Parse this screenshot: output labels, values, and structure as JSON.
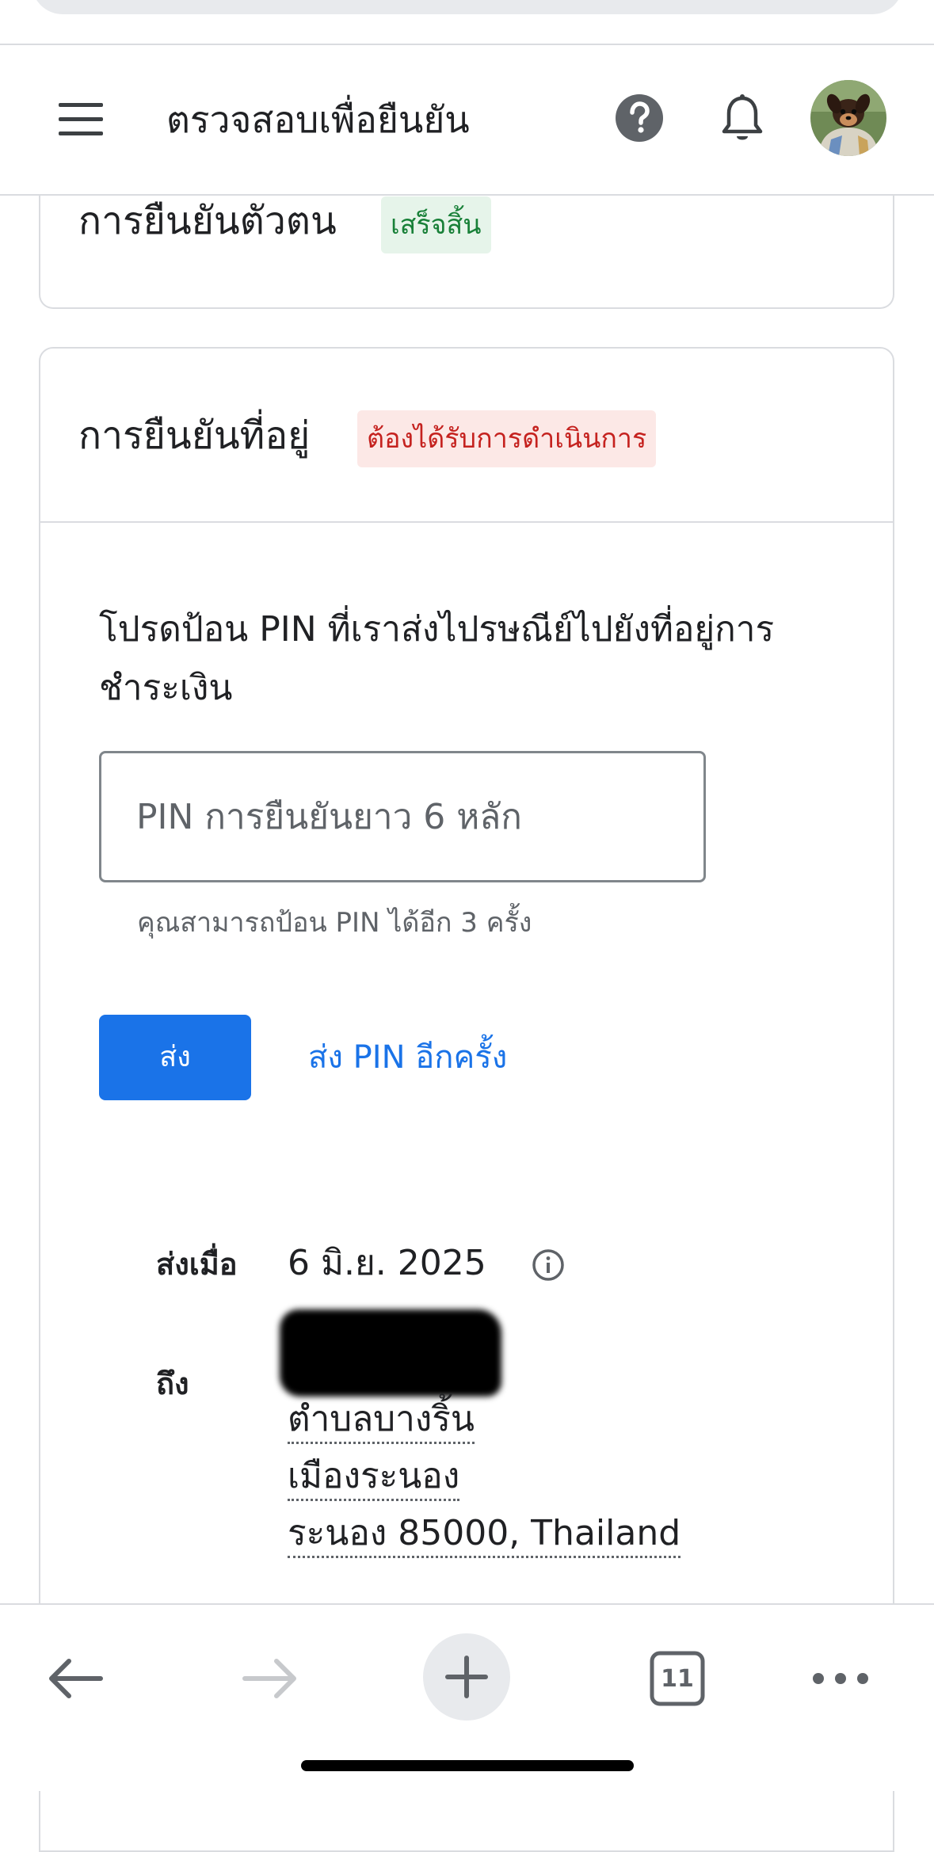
{
  "header": {
    "title": "ตรวจสอบเพื่อยืนยัน",
    "menu_icon": "menu-icon",
    "help_icon": "help-icon",
    "notifications_icon": "bell-icon",
    "avatar": "account-avatar"
  },
  "identity_card": {
    "title": "การยืนยันตัวตน",
    "status": "เสร็จสิ้น"
  },
  "address_card": {
    "title": "การยืนยันที่อยู่",
    "status": "ต้องได้รับการดำเนินการ",
    "instruction": "โปรดป้อน PIN ที่เราส่งไปรษณีย์ไปยังที่อยู่การชำระเงิน",
    "pin_input": {
      "placeholder": "PIN การยืนยันยาว 6 หลัก",
      "value": ""
    },
    "helper_text": "คุณสามารถป้อน PIN ได้อีก 3 ครั้ง",
    "submit_label": "ส่ง",
    "resend_label": "ส่ง PIN อีกครั้ง",
    "sent_label": "ส่งเมื่อ",
    "sent_date": "6 มิ.ย. 2025",
    "to_label": "ถึง",
    "address_lines": [
      "ตำบลบางริ้น",
      "เมืองระนอง",
      "ระนอง 85000, Thailand"
    ]
  },
  "browser_toolbar": {
    "tab_count": "11",
    "icons": [
      "back-arrow-icon",
      "forward-arrow-icon",
      "new-tab-plus-icon",
      "tabs-icon",
      "more-icon"
    ]
  },
  "colors": {
    "primary_blue": "#1a73e8",
    "success_green": "#188038",
    "success_bg": "#e6f4ea",
    "error_red": "#c5221f",
    "error_bg": "#fce8e6",
    "border": "#dadce0"
  }
}
